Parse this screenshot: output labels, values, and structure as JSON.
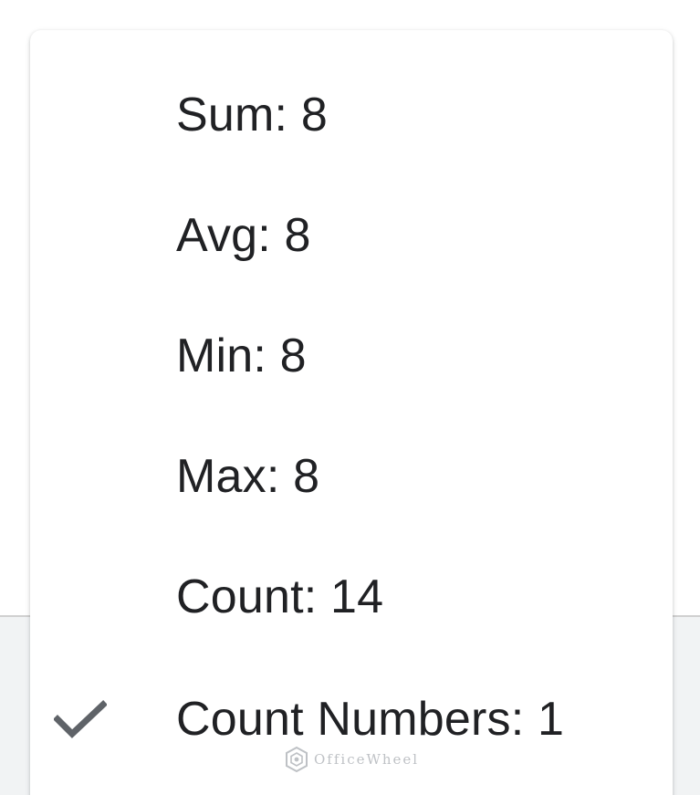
{
  "menu": {
    "items": [
      {
        "label": "Sum: 8",
        "checked": false
      },
      {
        "label": "Avg: 8",
        "checked": false
      },
      {
        "label": "Min: 8",
        "checked": false
      },
      {
        "label": "Max: 8",
        "checked": false
      },
      {
        "label": "Count: 14",
        "checked": false
      },
      {
        "label": "Count Numbers: 1",
        "checked": true
      }
    ],
    "check_icon": "checkmark-icon"
  },
  "watermark": {
    "text": "OfficeWheel",
    "icon": "officewheel-logo-icon"
  },
  "colors": {
    "text": "#202124",
    "check": "#5f6368",
    "menu_bg": "#ffffff",
    "page_bg": "#f1f3f4"
  }
}
